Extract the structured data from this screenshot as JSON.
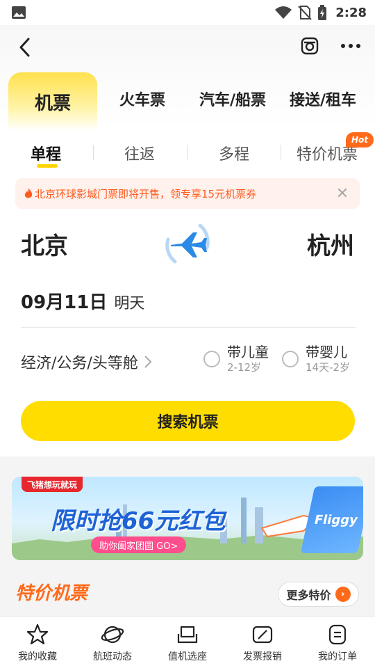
{
  "status_bar": {
    "time": "2:28"
  },
  "header": {
    "back_icon": "back-arrow-icon",
    "scan_icon": "camera-icon",
    "more_icon": "more-dots-icon"
  },
  "main_tabs": [
    {
      "label": "机票"
    },
    {
      "label": "火车票"
    },
    {
      "label": "汽车/船票"
    },
    {
      "label": "接送/租车"
    }
  ],
  "trip_tabs": [
    {
      "label": "单程"
    },
    {
      "label": "往返"
    },
    {
      "label": "多程"
    },
    {
      "label": "特价机票"
    }
  ],
  "hot_badge": "Hot",
  "notice": {
    "text": "北京环球影城门票即将开售，领专享15元机票券"
  },
  "route": {
    "from": "北京",
    "to": "杭州"
  },
  "date": {
    "main": "09月11日",
    "sub": "明天"
  },
  "cabin": {
    "label": "经济/公务/头等舱"
  },
  "options": [
    {
      "label": "带儿童",
      "sub": "2-12岁"
    },
    {
      "label": "带婴儿",
      "sub": "14天-2岁"
    }
  ],
  "search_button": "搜索机票",
  "promo": {
    "tag": "飞猪想玩就玩",
    "title": "限时抢66元红包",
    "subtitle": "助你阖家团圆 GO>",
    "ticket": "Fliggy"
  },
  "special": {
    "title": "特价机票",
    "more": "更多特价"
  },
  "bottom_nav": [
    {
      "label": "我的收藏"
    },
    {
      "label": "航班动态"
    },
    {
      "label": "值机选座"
    },
    {
      "label": "发票报销"
    },
    {
      "label": "我的订单"
    }
  ],
  "colors": {
    "accent": "#ffdd00",
    "orange": "#ff6a1a",
    "notice_bg": "#fff1ec"
  }
}
